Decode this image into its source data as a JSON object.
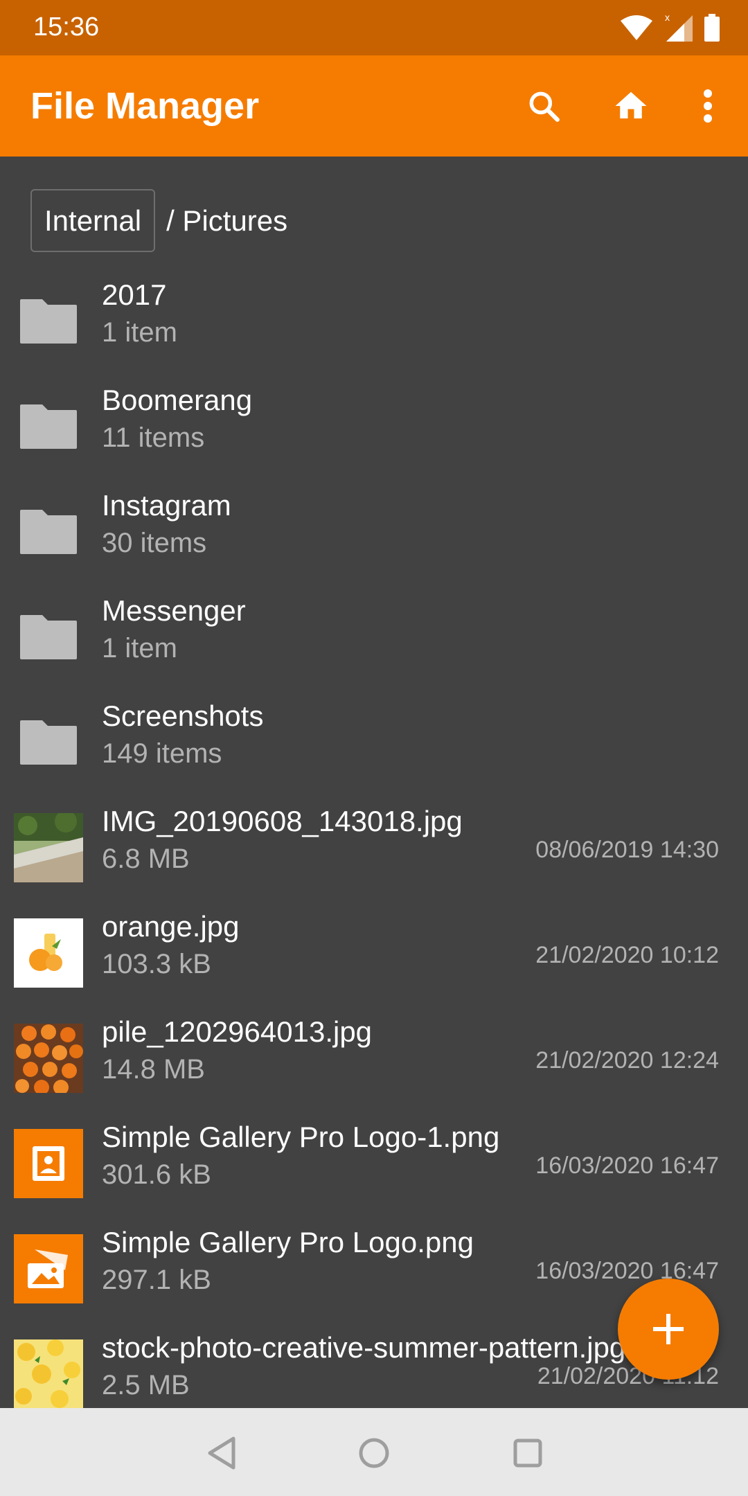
{
  "status_bar": {
    "time": "15:36"
  },
  "app_bar": {
    "title": "File Manager"
  },
  "breadcrumb": {
    "root": "Internal",
    "path": "/ Pictures"
  },
  "folders": [
    {
      "name": "2017",
      "count": "1 item"
    },
    {
      "name": "Boomerang",
      "count": "11 items"
    },
    {
      "name": "Instagram",
      "count": "30 items"
    },
    {
      "name": "Messenger",
      "count": "1 item"
    },
    {
      "name": "Screenshots",
      "count": "149 items"
    }
  ],
  "files": [
    {
      "name": "IMG_20190608_143018.jpg",
      "size": "6.8 MB",
      "date": "08/06/2019 14:30"
    },
    {
      "name": "orange.jpg",
      "size": "103.3 kB",
      "date": "21/02/2020 10:12"
    },
    {
      "name": "pile_1202964013.jpg",
      "size": "14.8 MB",
      "date": "21/02/2020 12:24"
    },
    {
      "name": "Simple Gallery Pro Logo-1.png",
      "size": "301.6 kB",
      "date": "16/03/2020 16:47"
    },
    {
      "name": "Simple Gallery Pro Logo.png",
      "size": "297.1 kB",
      "date": "16/03/2020 16:47"
    },
    {
      "name": "stock-photo-creative-summer-pattern.jpg",
      "size": "2.5 MB",
      "date": "21/02/2020 11:12"
    }
  ],
  "icons": {
    "search": "search-icon",
    "home": "home-icon",
    "more": "more-vert-icon",
    "folder": "folder-icon",
    "add": "plus-icon"
  },
  "colors": {
    "accent": "#f57c00",
    "status_bar": "#c86200",
    "background": "#424242",
    "secondary_text": "#b3b3b3",
    "folder_icon": "#bdbdbd"
  }
}
